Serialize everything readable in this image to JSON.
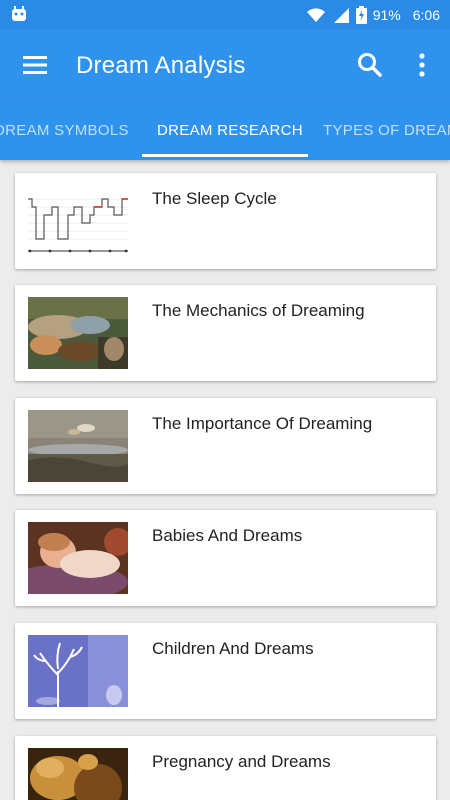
{
  "status_bar": {
    "battery_percent": "91%",
    "time": "6:06"
  },
  "app_bar": {
    "title": "Dream Analysis"
  },
  "tabs": [
    {
      "label": "DREAM SYMBOLS",
      "active": false
    },
    {
      "label": "DREAM RESEARCH",
      "active": true
    },
    {
      "label": "TYPES OF DREAMS",
      "active": false
    }
  ],
  "articles": [
    {
      "title": "The Sleep Cycle",
      "thumbnail": "sleep-cycle-graph"
    },
    {
      "title": "The Mechanics of Dreaming",
      "thumbnail": "painting-sleeping-figures"
    },
    {
      "title": "The Importance Of Dreaming",
      "thumbnail": "painting-flying-figure"
    },
    {
      "title": "Babies And Dreams",
      "thumbnail": "painting-sleeping-child"
    },
    {
      "title": "Children And Dreams",
      "thumbnail": "illustration-white-tree"
    },
    {
      "title": "Pregnancy and Dreams",
      "thumbnail": "painting-golden-figures"
    }
  ],
  "colors": {
    "app_bar": "#2f93ee",
    "status_bar": "#2a8ae6",
    "background": "#ececec"
  }
}
